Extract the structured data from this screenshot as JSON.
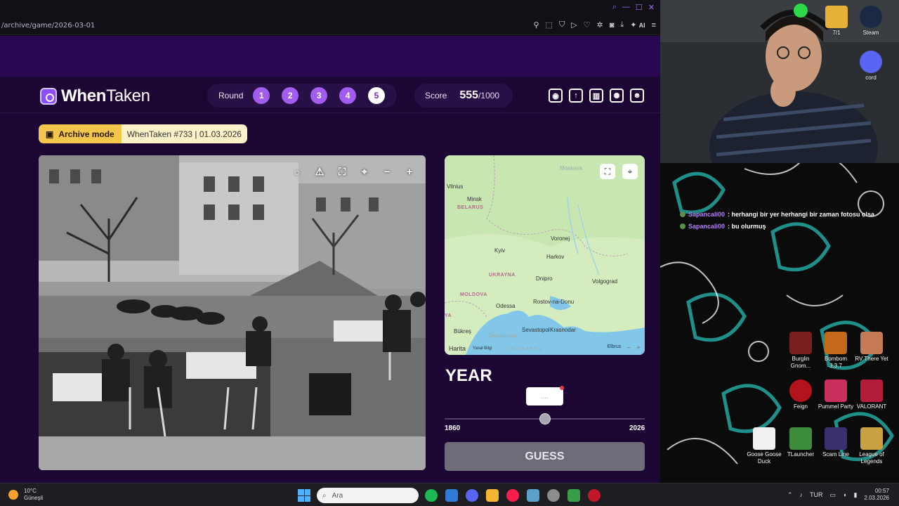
{
  "browser": {
    "url": "/archive/game/2026-03-01",
    "ai_label": "AI"
  },
  "app": {
    "logo_bold": "When",
    "logo_thin": "Taken",
    "round_label": "Round",
    "rounds": [
      "1",
      "2",
      "3",
      "4",
      "5"
    ],
    "active_round": "5",
    "score_label": "Score",
    "score_value": "555",
    "score_max": "/1000",
    "archive_mode": "Archive mode",
    "game_info": "WhenTaken #733 | 01.03.2026"
  },
  "map": {
    "cities": [
      {
        "name": "Moskova",
        "muted": true
      },
      {
        "name": "Vilnius"
      },
      {
        "name": "Minsk"
      },
      {
        "name": "Voronej"
      },
      {
        "name": "Kyiv"
      },
      {
        "name": "Harkov"
      },
      {
        "name": "Dnipro"
      },
      {
        "name": "Volgograd"
      },
      {
        "name": "Odessa"
      },
      {
        "name": "Rostov-na-Donu"
      },
      {
        "name": "Bükreş"
      },
      {
        "name": "Sevastopol"
      },
      {
        "name": "Krasnodar"
      },
      {
        "name": "Sevastopol",
        "muted": true
      }
    ],
    "countries": [
      "BELARUS",
      "UKRAYNA",
      "MOLDOVA",
      "YA"
    ],
    "sea_label": "Karadeniz",
    "attribution_brand": "Harita",
    "attribution_legal": "Yasal Bilgi",
    "attribution_right": "Elbrus"
  },
  "guess": {
    "year_title": "YEAR",
    "year_placeholder": "....",
    "slider_min": "1860",
    "slider_max": "2026",
    "slider_value": 1943,
    "guess_button": "GUESS"
  },
  "chat": [
    {
      "user": "Sapancali00",
      "message": ": herhangi bir yer herhangi bir zaman fotosu olsa"
    },
    {
      "user": "Sapancali00",
      "message": ": bu olurmuş"
    }
  ],
  "desktop_icons": [
    {
      "label": "7/1",
      "color": "#e8b23a"
    },
    {
      "label": "Steam",
      "color": "#1b2a44"
    },
    {
      "label": "cord",
      "color": "#5865f2"
    },
    {
      "label": "Burglin Gnom...",
      "color": "#7a1f1f"
    },
    {
      "label": "Bombom 3.3.7",
      "color": "#c26a1a"
    },
    {
      "label": "RV There Yet",
      "color": "#c47b55"
    },
    {
      "label": "Feign",
      "color": "#b3131a"
    },
    {
      "label": "Pummel Party",
      "color": "#c9305d"
    },
    {
      "label": "VALORANT",
      "color": "#b21e3a"
    },
    {
      "label": "Goose Goose Duck",
      "color": "#f0f0f0"
    },
    {
      "label": "TLauncher",
      "color": "#3d8b3d"
    },
    {
      "label": "Scam Line",
      "color": "#3b2f6e"
    },
    {
      "label": "League of Legends",
      "color": "#c9a042"
    }
  ],
  "taskbar": {
    "temperature": "10°C",
    "weather": "Güneşli",
    "search_placeholder": "Ara",
    "language": "TUR",
    "time": "00:57",
    "date": "2.03.2026"
  }
}
